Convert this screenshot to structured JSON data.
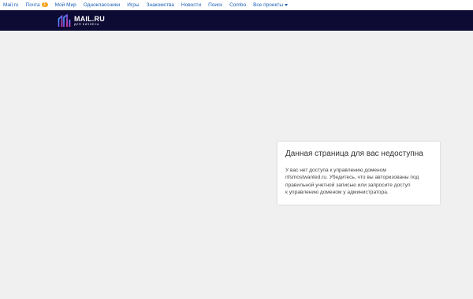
{
  "topnav": {
    "items": [
      {
        "label": "Mail.ru"
      },
      {
        "label": "Почта",
        "badge": "1"
      },
      {
        "label": "Мой Мир"
      },
      {
        "label": "Одноклассники"
      },
      {
        "label": "Игры"
      },
      {
        "label": "Знакомства"
      },
      {
        "label": "Новости"
      },
      {
        "label": "Поиск"
      },
      {
        "label": "Combo"
      },
      {
        "label": "Все проекты"
      }
    ]
  },
  "header": {
    "logo_main": "MAIL.RU",
    "logo_sub": "ДЛЯ БИЗНЕСА",
    "logo_icon": "mailru-business-logo-icon"
  },
  "card": {
    "title": "Данная страница для вас недоступна",
    "lines": [
      "У вас нет доступа к управлению доменом",
      "nfsmostwanted.ru. Убедитесь, что вы авторизованы под",
      "правильной учетной записью или запросите доступ",
      "к управлению доменом у администратора."
    ]
  },
  "colors": {
    "header_bg": "#0d0a33",
    "link": "#1a5fb4",
    "badge": "#f5a623",
    "page_bg": "#f0f0f0"
  }
}
